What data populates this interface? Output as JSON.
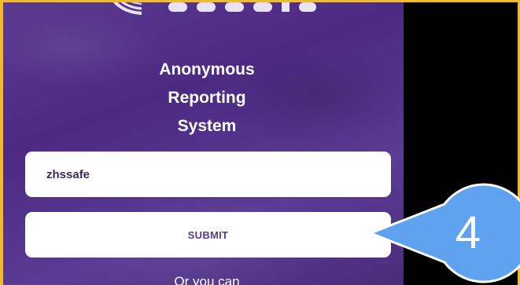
{
  "header": {
    "logo_icon": "brand-logo-partial",
    "title_lines": [
      "Anonymous",
      "Reporting",
      "System"
    ]
  },
  "form": {
    "access_code_value": "zhssafe",
    "submit_label": "SUBMIT",
    "alternate_text": "Or you can"
  },
  "callout": {
    "step_number": "4",
    "color": "#5ea2f0"
  },
  "colors": {
    "panel_purple": "#4f2d86",
    "frame_border": "#f2b92a",
    "button_text": "#5a3b8c",
    "background": "#000000"
  }
}
